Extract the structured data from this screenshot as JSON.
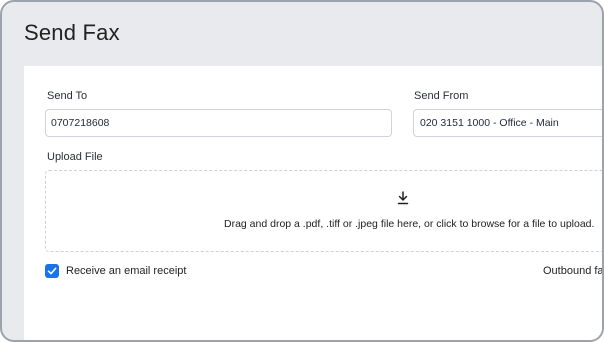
{
  "page": {
    "title": "Send Fax"
  },
  "form": {
    "send_to": {
      "label": "Send To",
      "value": "0707218608"
    },
    "send_from": {
      "label": "Send From",
      "selected": "020 3151 1000 - Office - Main"
    },
    "upload": {
      "label": "Upload File",
      "dropzone_text": "Drag and drop a .pdf, .tiff or .jpeg file here, or click to browse for a file to upload.",
      "icon": "download-icon"
    },
    "email_receipt": {
      "label": "Receive an email receipt",
      "checked": true
    },
    "outbound_text": "Outbound fax"
  },
  "colors": {
    "accent": "#1a73e8",
    "header_bg": "#e9eaee",
    "border": "#cfd4dc"
  }
}
